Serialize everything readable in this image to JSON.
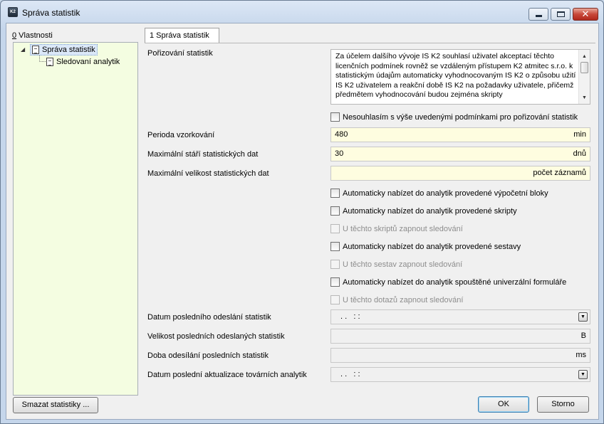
{
  "window": {
    "title": "Správa statistik",
    "app_icon_text": "K2",
    "close_label": "✕"
  },
  "left_panel": {
    "label_key": "0",
    "label_rest": " Vlastnosti",
    "tree": {
      "root": "Správa statistik",
      "children": [
        "Sledovaní analytik"
      ]
    }
  },
  "tab": {
    "label": "1 Správa statistik"
  },
  "form": {
    "porizovani_label": "Pořizování statistik",
    "license_text": "Za účelem dalšího vývoje IS K2 souhlasí uživatel akceptací těchto licenčních podmínek rovněž se vzdáleným přístupem K2 atmitec s.r.o. k statistickým údajům automaticky vyhodnocovaným IS K2 o způsobu užití IS K2 uživatelem a reakční době IS K2 na požadavky uživatele, přičemž předmětem vyhodnocování budou zejména skripty",
    "disagree_label": "Nesouhlasím s výše uvedenými podmínkami pro pořizování statistik",
    "perioda_label": "Perioda vzorkování",
    "perioda_value": "480",
    "perioda_unit": "min",
    "max_stari_label": "Maximální stáří statistických dat",
    "max_stari_value": "30",
    "max_stari_unit": "dnů",
    "max_velikost_label": "Maximální velikost statistických dat",
    "max_velikost_value": "",
    "max_velikost_unit": "počet záznamů",
    "checks": [
      {
        "label": "Automaticky nabízet do analytik provedené výpočetní bloky",
        "enabled": true
      },
      {
        "label": "Automaticky nabízet do analytik provedené skripty",
        "enabled": true
      },
      {
        "label": "U těchto skriptů zapnout sledování",
        "enabled": false
      },
      {
        "label": "Automaticky nabízet do analytik provedené sestavy",
        "enabled": true
      },
      {
        "label": "U těchto sestav zapnout sledování",
        "enabled": false
      },
      {
        "label": "Automaticky nabízet do analytik spouštěné univerzální formuláře",
        "enabled": true
      },
      {
        "label": "U těchto dotazů zapnout sledování",
        "enabled": false
      }
    ],
    "datum_odeslani_label": "Datum posledního odeslání statistik",
    "datum_odeslani_value": ". .   : :",
    "velikost_label": "Velikost posledních odeslaných statistik",
    "velikost_unit": "B",
    "doba_label": "Doba odesílání posledních statistik",
    "doba_unit": "ms",
    "datum_aktualizace_label": "Datum poslední aktualizace továrních analytik",
    "datum_aktualizace_value": ". .   : :"
  },
  "buttons": {
    "clear": "Smazat statistiky ...",
    "ok": "OK",
    "cancel": "Storno"
  },
  "colors": {
    "field_bg": "#fefde0",
    "tree_bg": "#f4fde1",
    "close_red": "#c8483a"
  }
}
